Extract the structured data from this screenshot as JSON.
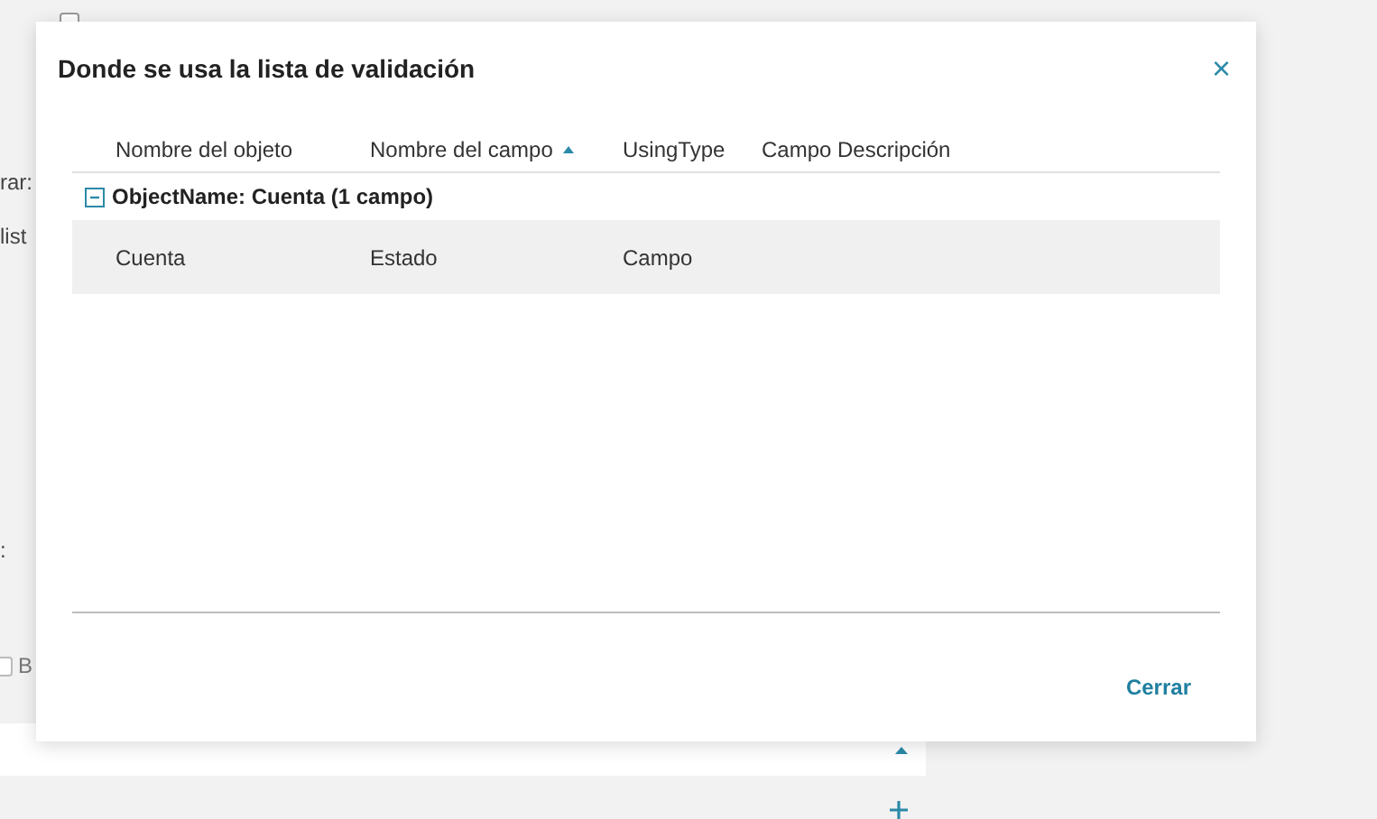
{
  "background": {
    "top_checkbox": {
      "checked": false
    },
    "fragments": [
      {
        "text": "rar:"
      },
      {
        "text": "list"
      },
      {
        "text": ":"
      },
      {
        "text": "B",
        "kind": "checkbox",
        "checked": false
      }
    ]
  },
  "dialog": {
    "title": "Donde se usa la lista de validación",
    "close": "×",
    "table": {
      "columns": [
        {
          "label": "Nombre del objeto",
          "sorted": false
        },
        {
          "label": "Nombre del campo",
          "sorted": true
        },
        {
          "label": "UsingType",
          "sorted": false
        },
        {
          "label": "Campo Descripción",
          "sorted": false
        }
      ],
      "groups": [
        {
          "label": "ObjectName: Cuenta (1 campo)",
          "expanded": true,
          "rows": [
            [
              "Cuenta",
              "Estado",
              "Campo",
              ""
            ]
          ]
        }
      ]
    },
    "buttons": [
      "Cerrar"
    ]
  }
}
